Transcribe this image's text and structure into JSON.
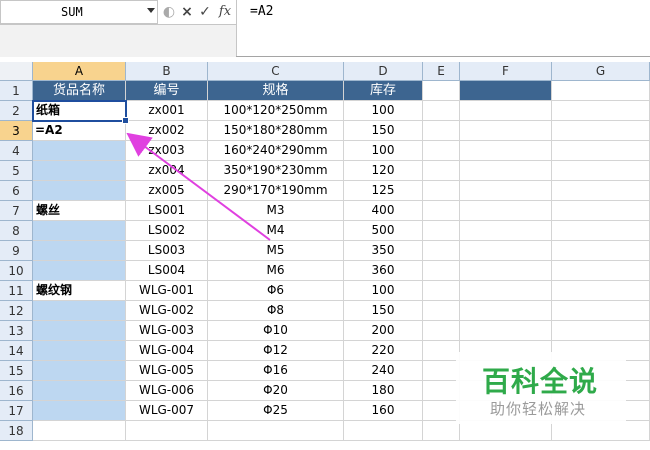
{
  "formula_bar": {
    "name_box": "SUM",
    "cancel_icon": "×",
    "enter_icon": "✓",
    "fx_label": "fx",
    "formula": "=A2"
  },
  "columns": [
    "A",
    "B",
    "C",
    "D",
    "E",
    "F",
    "G"
  ],
  "rows": [
    "1",
    "2",
    "3",
    "4",
    "5",
    "6",
    "7",
    "8",
    "9",
    "10",
    "11",
    "12",
    "13",
    "14",
    "15",
    "16",
    "17",
    "18"
  ],
  "table": {
    "headers": [
      "货品名称",
      "编号",
      "规格",
      "库存"
    ],
    "data": [
      [
        "纸箱",
        "zx001",
        "100*120*250mm",
        "100"
      ],
      [
        "=A2",
        "zx002",
        "150*180*280mm",
        "150"
      ],
      [
        "",
        "zx003",
        "160*240*290mm",
        "100"
      ],
      [
        "",
        "zx004",
        "350*190*230mm",
        "120"
      ],
      [
        "",
        "zx005",
        "290*170*190mm",
        "125"
      ],
      [
        "螺丝",
        "LS001",
        "M3",
        "400"
      ],
      [
        "",
        "LS002",
        "M4",
        "500"
      ],
      [
        "",
        "LS003",
        "M5",
        "350"
      ],
      [
        "",
        "LS004",
        "M6",
        "360"
      ],
      [
        "螺纹钢",
        "WLG-001",
        "Φ6",
        "100"
      ],
      [
        "",
        "WLG-002",
        "Φ8",
        "150"
      ],
      [
        "",
        "WLG-003",
        "Φ10",
        "200"
      ],
      [
        "",
        "WLG-004",
        "Φ12",
        "220"
      ],
      [
        "",
        "WLG-005",
        "Φ16",
        "240"
      ],
      [
        "",
        "WLG-006",
        "Φ20",
        "180"
      ],
      [
        "",
        "WLG-007",
        "Φ25",
        "160"
      ]
    ]
  },
  "watermark": {
    "title": "百科全说",
    "subtitle": "助你轻松解决"
  },
  "colors": {
    "header_fill": "#3d6590",
    "selection_fill": "#bdd7f1",
    "arrow": "#e040e0",
    "watermark": "#2faa4a"
  }
}
